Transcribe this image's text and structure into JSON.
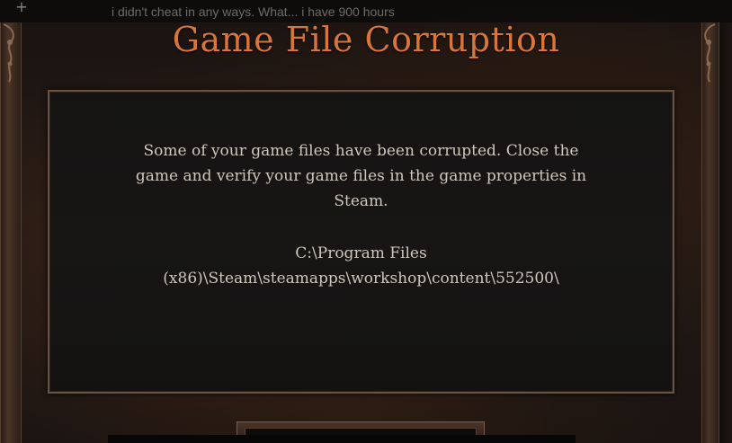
{
  "chat": {
    "plus_glyph": "+",
    "message": "i didn't cheat in any ways. What... i have 900 hours"
  },
  "dialog": {
    "title": "Game File Corruption",
    "message": "Some of your game files have been corrupted. Close the game and verify your game files in the game properties in Steam.",
    "path": "C:\\Program Files (x86)\\Steam\\steamapps\\workshop\\content\\552500\\"
  },
  "colors": {
    "title": "#d7753a",
    "body_text": "#cfc7bc",
    "panel_border": "#6b5240",
    "panel_bg": "#161514"
  }
}
